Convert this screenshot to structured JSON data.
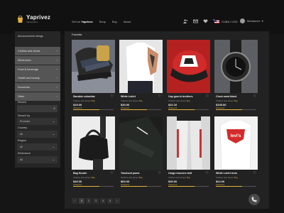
{
  "header": {
    "brand": "Yaprivez",
    "brand_sub": "Marketplace",
    "nav": [
      "Sell on",
      "Yaprivez",
      "Shop",
      "Buy",
      "About"
    ],
    "locale": "CUBA / USD",
    "user": "Mohamed"
  },
  "sidebar": {
    "top_label": "Announcement strings",
    "categories": [
      {
        "label": "Clothes and shoes"
      },
      {
        "label": "Electronics"
      },
      {
        "label": "Food & beverage"
      },
      {
        "label": "Health and beauty"
      },
      {
        "label": "Souvenirs"
      },
      {
        "label": "Other"
      }
    ],
    "filters": {
      "search_label": "Search",
      "search_by_label": "Search by",
      "search_by_value": "Products",
      "country_label": "Country",
      "country_value": "All",
      "region_label": "Region",
      "region_value": "All",
      "relevance_label": "Relevance",
      "relevance_value": "All"
    }
  },
  "main": {
    "title": "Favorite",
    "products": [
      {
        "name": "Sandals columbia",
        "category": "Clothes and shoes",
        "tag": "Buy",
        "price": "$19.00",
        "stock": "Arrived 3"
      },
      {
        "name": "White t-shirt",
        "category": "Clothes and shoes",
        "tag": "Buy",
        "price": "$30.00",
        "stock": "Arrived 3"
      },
      {
        "name": "Cap goorin brothers",
        "category": "Clothes and shoes",
        "tag": "Buy",
        "price": "$22.10",
        "stock": "Arrived 3"
      },
      {
        "name": "Clock amst black",
        "category": "Clothes and shoes",
        "tag": "Buy",
        "price": "$105.00",
        "stock": "Arrived 3"
      },
      {
        "name": "Bag Hunter",
        "category": "Clothes and shoes",
        "tag": "Buy",
        "price": "$40.00",
        "stock": "Arrived 3"
      },
      {
        "name": "Tracksuit puma",
        "category": "Clothes and shoes",
        "tag": "Buy",
        "price": "$60.00",
        "stock": "Arrived 3"
      },
      {
        "name": "Cargo trousers belt",
        "category": "Clothes and shoes",
        "tag": "Buy",
        "price": "$30.00",
        "stock": "Arrived 3"
      },
      {
        "name": "White t-shirt levis",
        "category": "Clothes and shoes",
        "tag": "Buy",
        "price": "$24.00",
        "stock": "Arrived 3"
      }
    ],
    "pagination": [
      "‹",
      "1",
      "2",
      "3",
      "4",
      "5",
      "›"
    ]
  },
  "icons": {
    "logo": "shopping-bag-icon",
    "header": [
      "users-icon",
      "mail-icon",
      "heart-icon",
      "cart-icon"
    ],
    "phone": "phone-icon"
  },
  "colors": {
    "accent": "#e3b23c",
    "background": "#151515",
    "panel": "#222222",
    "sidebar_item": "#555555"
  }
}
